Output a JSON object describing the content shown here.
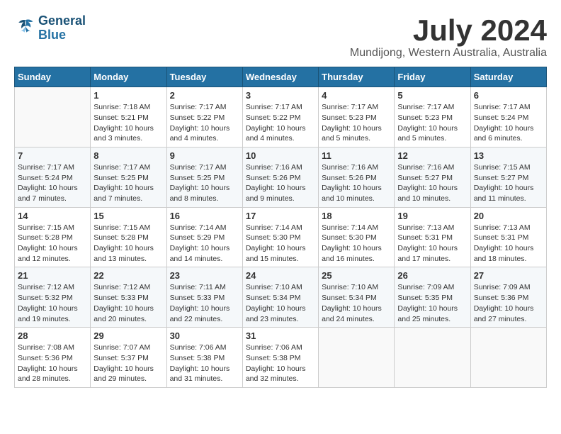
{
  "logo": {
    "line1": "General",
    "line2": "Blue"
  },
  "title": "July 2024",
  "location": "Mundijong, Western Australia, Australia",
  "headers": [
    "Sunday",
    "Monday",
    "Tuesday",
    "Wednesday",
    "Thursday",
    "Friday",
    "Saturday"
  ],
  "weeks": [
    [
      {
        "day": "",
        "info": ""
      },
      {
        "day": "1",
        "info": "Sunrise: 7:18 AM\nSunset: 5:21 PM\nDaylight: 10 hours\nand 3 minutes."
      },
      {
        "day": "2",
        "info": "Sunrise: 7:17 AM\nSunset: 5:22 PM\nDaylight: 10 hours\nand 4 minutes."
      },
      {
        "day": "3",
        "info": "Sunrise: 7:17 AM\nSunset: 5:22 PM\nDaylight: 10 hours\nand 4 minutes."
      },
      {
        "day": "4",
        "info": "Sunrise: 7:17 AM\nSunset: 5:23 PM\nDaylight: 10 hours\nand 5 minutes."
      },
      {
        "day": "5",
        "info": "Sunrise: 7:17 AM\nSunset: 5:23 PM\nDaylight: 10 hours\nand 5 minutes."
      },
      {
        "day": "6",
        "info": "Sunrise: 7:17 AM\nSunset: 5:24 PM\nDaylight: 10 hours\nand 6 minutes."
      }
    ],
    [
      {
        "day": "7",
        "info": "Sunrise: 7:17 AM\nSunset: 5:24 PM\nDaylight: 10 hours\nand 7 minutes."
      },
      {
        "day": "8",
        "info": "Sunrise: 7:17 AM\nSunset: 5:25 PM\nDaylight: 10 hours\nand 7 minutes."
      },
      {
        "day": "9",
        "info": "Sunrise: 7:17 AM\nSunset: 5:25 PM\nDaylight: 10 hours\nand 8 minutes."
      },
      {
        "day": "10",
        "info": "Sunrise: 7:16 AM\nSunset: 5:26 PM\nDaylight: 10 hours\nand 9 minutes."
      },
      {
        "day": "11",
        "info": "Sunrise: 7:16 AM\nSunset: 5:26 PM\nDaylight: 10 hours\nand 10 minutes."
      },
      {
        "day": "12",
        "info": "Sunrise: 7:16 AM\nSunset: 5:27 PM\nDaylight: 10 hours\nand 10 minutes."
      },
      {
        "day": "13",
        "info": "Sunrise: 7:15 AM\nSunset: 5:27 PM\nDaylight: 10 hours\nand 11 minutes."
      }
    ],
    [
      {
        "day": "14",
        "info": "Sunrise: 7:15 AM\nSunset: 5:28 PM\nDaylight: 10 hours\nand 12 minutes."
      },
      {
        "day": "15",
        "info": "Sunrise: 7:15 AM\nSunset: 5:28 PM\nDaylight: 10 hours\nand 13 minutes."
      },
      {
        "day": "16",
        "info": "Sunrise: 7:14 AM\nSunset: 5:29 PM\nDaylight: 10 hours\nand 14 minutes."
      },
      {
        "day": "17",
        "info": "Sunrise: 7:14 AM\nSunset: 5:30 PM\nDaylight: 10 hours\nand 15 minutes."
      },
      {
        "day": "18",
        "info": "Sunrise: 7:14 AM\nSunset: 5:30 PM\nDaylight: 10 hours\nand 16 minutes."
      },
      {
        "day": "19",
        "info": "Sunrise: 7:13 AM\nSunset: 5:31 PM\nDaylight: 10 hours\nand 17 minutes."
      },
      {
        "day": "20",
        "info": "Sunrise: 7:13 AM\nSunset: 5:31 PM\nDaylight: 10 hours\nand 18 minutes."
      }
    ],
    [
      {
        "day": "21",
        "info": "Sunrise: 7:12 AM\nSunset: 5:32 PM\nDaylight: 10 hours\nand 19 minutes."
      },
      {
        "day": "22",
        "info": "Sunrise: 7:12 AM\nSunset: 5:33 PM\nDaylight: 10 hours\nand 20 minutes."
      },
      {
        "day": "23",
        "info": "Sunrise: 7:11 AM\nSunset: 5:33 PM\nDaylight: 10 hours\nand 22 minutes."
      },
      {
        "day": "24",
        "info": "Sunrise: 7:10 AM\nSunset: 5:34 PM\nDaylight: 10 hours\nand 23 minutes."
      },
      {
        "day": "25",
        "info": "Sunrise: 7:10 AM\nSunset: 5:34 PM\nDaylight: 10 hours\nand 24 minutes."
      },
      {
        "day": "26",
        "info": "Sunrise: 7:09 AM\nSunset: 5:35 PM\nDaylight: 10 hours\nand 25 minutes."
      },
      {
        "day": "27",
        "info": "Sunrise: 7:09 AM\nSunset: 5:36 PM\nDaylight: 10 hours\nand 27 minutes."
      }
    ],
    [
      {
        "day": "28",
        "info": "Sunrise: 7:08 AM\nSunset: 5:36 PM\nDaylight: 10 hours\nand 28 minutes."
      },
      {
        "day": "29",
        "info": "Sunrise: 7:07 AM\nSunset: 5:37 PM\nDaylight: 10 hours\nand 29 minutes."
      },
      {
        "day": "30",
        "info": "Sunrise: 7:06 AM\nSunset: 5:38 PM\nDaylight: 10 hours\nand 31 minutes."
      },
      {
        "day": "31",
        "info": "Sunrise: 7:06 AM\nSunset: 5:38 PM\nDaylight: 10 hours\nand 32 minutes."
      },
      {
        "day": "",
        "info": ""
      },
      {
        "day": "",
        "info": ""
      },
      {
        "day": "",
        "info": ""
      }
    ]
  ]
}
